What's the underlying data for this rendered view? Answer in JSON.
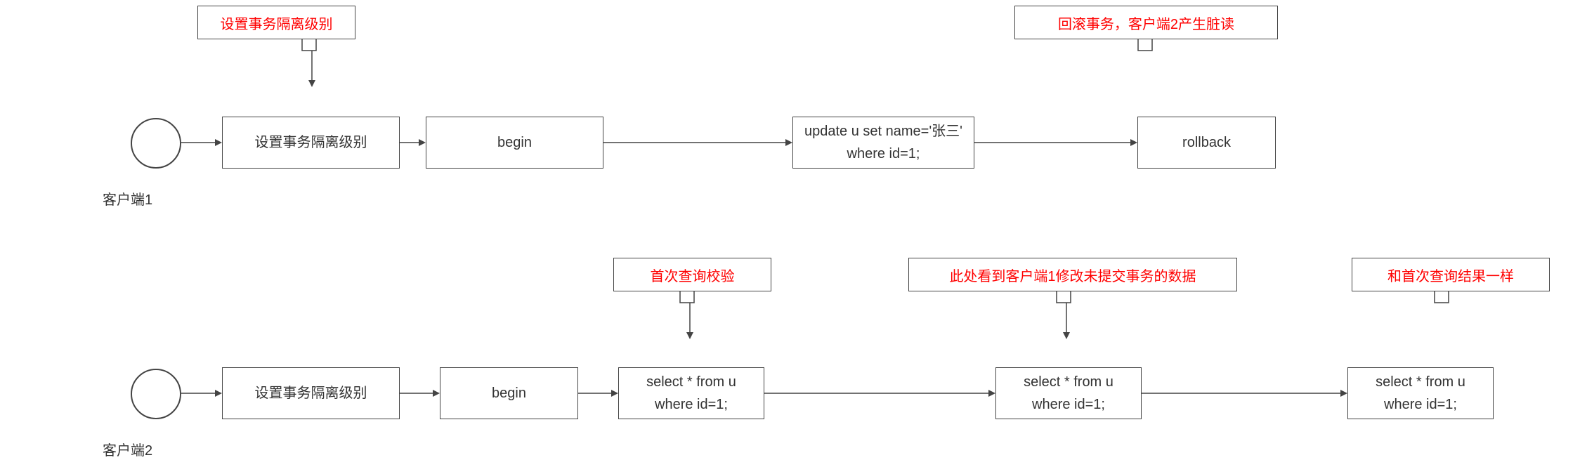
{
  "row1": {
    "clientLabel": "客户端1",
    "callout1": "设置事务隔离级别",
    "callout2": "回滚事务，客户端2产生脏读",
    "box1": "设置事务隔离级别",
    "box2": "begin",
    "box3_line1": "update u set name='张三'",
    "box3_line2": "where id=1;",
    "box4": "rollback"
  },
  "row2": {
    "clientLabel": "客户端2",
    "callout1": "首次查询校验",
    "callout2": "此处看到客户端1修改未提交事务的数据",
    "callout3": "和首次查询结果一样",
    "box1": "设置事务隔离级别",
    "box2": "begin",
    "box3_line1": "select * from u",
    "box3_line2": "where id=1;",
    "box4_line1": "select * from u",
    "box4_line2": "where id=1;",
    "box5_line1": "select * from u",
    "box5_line2": "where id=1;"
  }
}
